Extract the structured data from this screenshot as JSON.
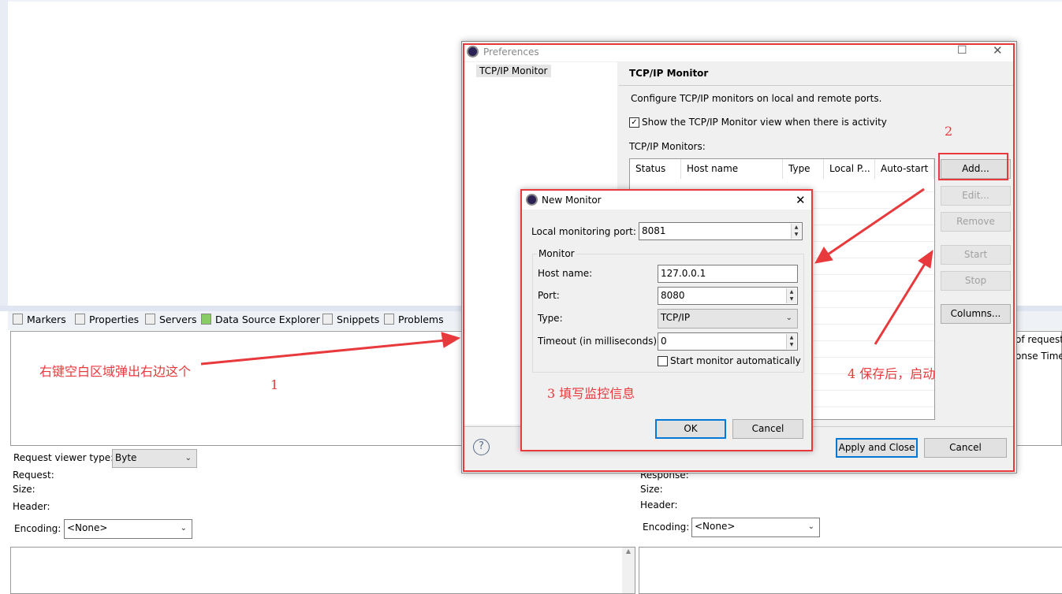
{
  "view_tabs": [
    {
      "label": "Markers",
      "icon": "markers-icon"
    },
    {
      "label": "Properties",
      "icon": "properties-icon"
    },
    {
      "label": "Servers",
      "icon": "servers-icon"
    },
    {
      "label": "Data Source Explorer",
      "icon": "database-icon"
    },
    {
      "label": "Snippets",
      "icon": "snippets-icon"
    },
    {
      "label": "Problems",
      "icon": "problems-icon"
    }
  ],
  "monitor_view": {
    "request_viewer_label": "Request viewer type:",
    "request_viewer_value": "Byte",
    "request_label": "Request:",
    "size_label": "Size:",
    "header_label": "Header:",
    "encoding_label": "Encoding:",
    "encoding_value": "<None>",
    "response_label": "Response:",
    "response_size_label": "Size:",
    "response_header_label": "Header:",
    "response_encoding_label": "Encoding:",
    "response_encoding_value": "<None>",
    "col_partial_1": "of request",
    "col_partial_2": "onse Time:"
  },
  "preferences": {
    "title": "Preferences",
    "tree_item": "TCP/IP Monitor",
    "page_title": "TCP/IP Monitor",
    "description": "Configure TCP/IP monitors on local and remote ports.",
    "show_view_checkbox": "Show the TCP/IP Monitor view when there is activity",
    "show_view_checked": true,
    "monitors_label": "TCP/IP Monitors:",
    "columns": [
      "Status",
      "Host name",
      "Type",
      "Local P...",
      "Auto-start"
    ],
    "buttons": {
      "add": "Add...",
      "edit": "Edit...",
      "remove": "Remove",
      "start": "Start",
      "stop": "Stop",
      "columns": "Columns..."
    },
    "apply_close": "Apply and Close",
    "cancel": "Cancel"
  },
  "new_monitor": {
    "title": "New Monitor",
    "local_port_label": "Local monitoring port:",
    "local_port_value": "8081",
    "group_label": "Monitor",
    "host_label": "Host name:",
    "host_value": "127.0.0.1",
    "port_label": "Port:",
    "port_value": "8080",
    "type_label": "Type:",
    "type_value": "TCP/IP",
    "timeout_label": "Timeout (in milliseconds):",
    "timeout_value": "0",
    "auto_start_label": "Start monitor automatically",
    "auto_start_checked": false,
    "ok": "OK",
    "cancel": "Cancel"
  },
  "annotations": {
    "step1_text": "右键空白区域弹出右边这个",
    "step1_num": "1",
    "step2_num": "2",
    "step3_text": "3  填写监控信息",
    "step4_text": "4  保存后，启动",
    "color": "#e8393c"
  }
}
